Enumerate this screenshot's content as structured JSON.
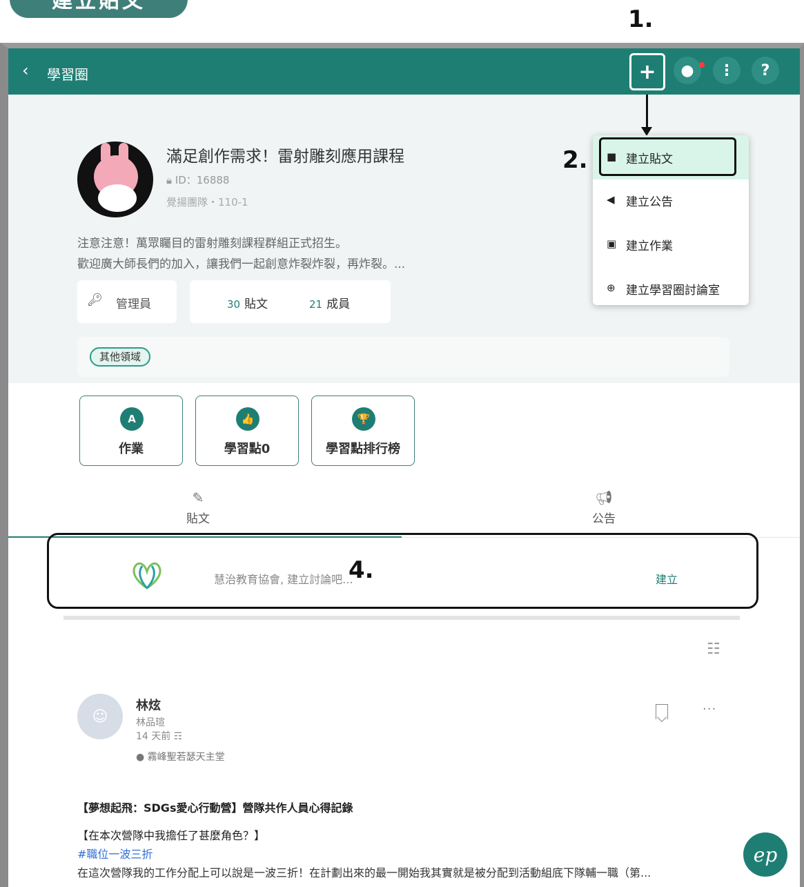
{
  "annotations": {
    "pill_label": "建立貼文",
    "step1": "1.",
    "step2": "2.",
    "step4": "4."
  },
  "topbar": {
    "back_icon": "chevron-left-icon",
    "title": "學習圈",
    "buttons": [
      "plus-icon",
      "chat-icon",
      "more-vertical-icon",
      "help-icon"
    ],
    "help_label": "?",
    "colors": {
      "bar": "#1f7e74",
      "accent": "#1f7e74",
      "notification": "#ff3b3b"
    }
  },
  "menu": {
    "items": [
      {
        "label": "建立貼文",
        "icon": "document-icon"
      },
      {
        "label": "建立公告",
        "icon": "megaphone-icon"
      },
      {
        "label": "建立作業",
        "icon": "add-document-icon"
      },
      {
        "label": "建立學習圈討論室",
        "icon": "add-chat-icon"
      }
    ]
  },
  "circle": {
    "title": "滿足創作需求！雷射雕刻應用課程",
    "id_label": "ID：16888",
    "sub": "覺揚團隊・110-1",
    "desc_line1": "注意注意！萬眾矚目的雷射雕刻課程群組正式招生。",
    "desc_line2": "歡迎廣大師長們的加入，讓我們一起創意炸裂炸裂，再炸裂。...",
    "admin_label": "管理員",
    "posts_count": "30",
    "posts_label": "貼文",
    "members_count": "21",
    "members_label": "成員",
    "tag": "其他領域"
  },
  "features": [
    {
      "label": "作業",
      "icon_glyph": "A",
      "icon": "homework-icon"
    },
    {
      "label": "學習點0",
      "icon_glyph": "👍",
      "icon": "thumbs-up-icon"
    },
    {
      "label": "學習點排行榜",
      "icon_glyph": "🏆",
      "icon": "trophy-icon"
    }
  ],
  "tabs": [
    {
      "label": "貼文",
      "icon": "edit-icon",
      "active": true
    },
    {
      "label": "公告",
      "icon": "megaphone-icon",
      "active": false
    }
  ],
  "composer": {
    "placeholder": "慧治教育協會, 建立討論吧...",
    "create_label": "建立"
  },
  "post": {
    "author": "林炫",
    "author_sub": "林品瑄",
    "time": "14 天前",
    "location": "霧峰聖若瑟天主堂",
    "title": "【夢想起飛：SDGs愛心行動營】營隊共作人員心得記錄",
    "question": "【在本次營隊中我擔任了甚麼角色？】",
    "hashtag": "#職位一波三折",
    "body": "在這次營隊我的工作分配上可以說是一波三折！在計劃出來的最一開始我其實就是被分配到活動組底下隊輔一職（第..."
  },
  "fab_label": "ep"
}
